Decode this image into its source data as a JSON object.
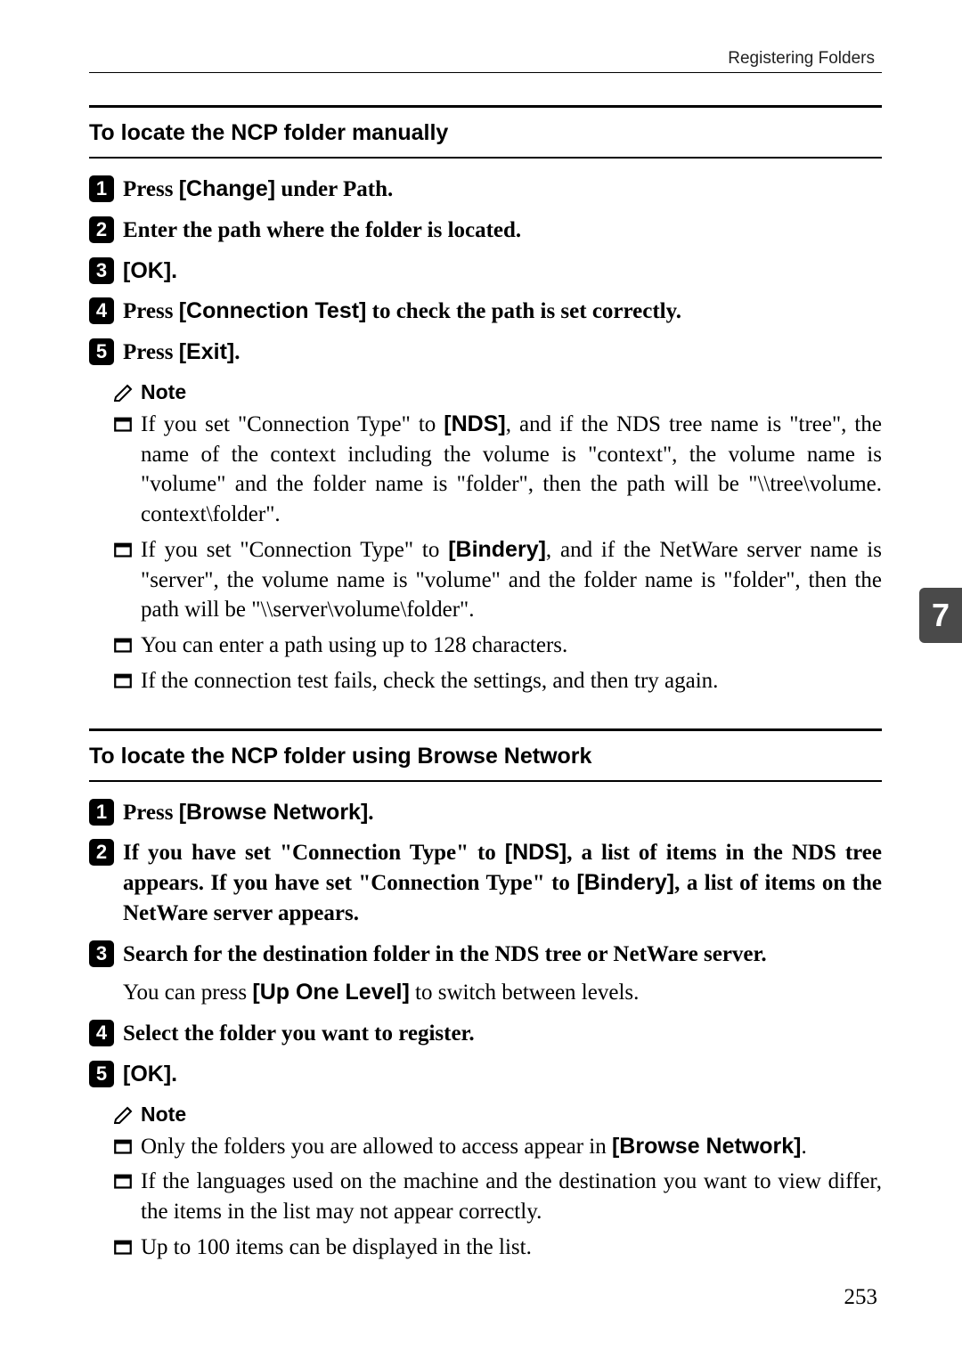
{
  "header": {
    "label": "Registering Folders"
  },
  "section1": {
    "title": "To locate the NCP folder manually",
    "steps": [
      {
        "num": "1",
        "prefix": "Press ",
        "btn": "[Change]",
        "suffix": " under Path."
      },
      {
        "num": "2",
        "prefix": "Enter the path where the folder is located.",
        "btn": "",
        "suffix": ""
      },
      {
        "num": "3",
        "prefix": "",
        "btn": "[OK]",
        "suffix": "."
      },
      {
        "num": "4",
        "prefix": "Press ",
        "btn": "[Connection Test]",
        "suffix": " to check the path is set correctly."
      },
      {
        "num": "5",
        "prefix": "Press ",
        "btn": "[Exit]",
        "suffix": "."
      }
    ],
    "note_label": "Note",
    "notes": [
      {
        "pre": "If you set \"Connection Type\" to ",
        "b": "[NDS]",
        "post": ", and if the NDS tree name is \"tree\", the name of the context including the volume is \"context\", the volume name is \"volume\" and the folder name is \"folder\", then the path will be \"\\\\tree\\volume. context\\folder\"."
      },
      {
        "pre": "If you set \"Connection Type\" to ",
        "b": "[Bindery]",
        "post": ", and if the NetWare server name is \"server\", the volume name is \"volume\" and the folder name is \"folder\", then the path will be \"\\\\server\\volume\\folder\"."
      },
      {
        "pre": "You can enter a path using up to 128 characters.",
        "b": "",
        "post": ""
      },
      {
        "pre": "If the connection test fails, check the settings, and then try again.",
        "b": "",
        "post": ""
      }
    ]
  },
  "section2": {
    "title": "To locate the NCP folder using Browse Network",
    "step1": {
      "num": "1",
      "prefix": "Press ",
      "btn": "[Browse Network]",
      "suffix": "."
    },
    "step2": {
      "num": "2",
      "pre": "If you have set \"Connection Type\" to ",
      "b1": "[NDS]",
      "mid": ", a list of items in the NDS tree appears. If you have set \"Connection Type\" to ",
      "b2": "[Bindery]",
      "post": ", a list of items on the NetWare server appears."
    },
    "step3": {
      "num": "3",
      "text": "Search for the destination folder in the NDS tree or NetWare server.",
      "sub_pre": "You can press ",
      "sub_b": "[Up One Level]",
      "sub_post": " to switch between levels."
    },
    "step4": {
      "num": "4",
      "text": "Select the folder you want to register."
    },
    "step5": {
      "num": "5",
      "btn": "[OK]",
      "suffix": "."
    },
    "note_label": "Note",
    "notes": [
      {
        "pre": "Only the folders you are allowed to access appear in ",
        "b": "[Browse Network]",
        "post": "."
      },
      {
        "pre": "If the languages used on the machine and the destination you want to view differ, the items in the list may not appear correctly.",
        "b": "",
        "post": ""
      },
      {
        "pre": "Up to 100 items can be displayed in the list.",
        "b": "",
        "post": ""
      }
    ]
  },
  "page": {
    "tab": "7",
    "number": "253"
  }
}
